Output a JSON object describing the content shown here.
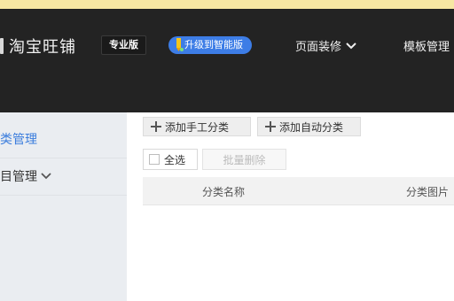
{
  "header": {
    "brand": "淘宝旺铺",
    "edition": "专业版",
    "upgrade_label": "升级到智能版",
    "nav": [
      {
        "label": "页面装修"
      },
      {
        "label": "模板管理"
      }
    ]
  },
  "sidebar": {
    "items": [
      {
        "label": "类管理",
        "active": true
      },
      {
        "label": "目管理"
      }
    ]
  },
  "toolbar": {
    "add_manual": "添加手工分类",
    "add_auto": "添加自动分类",
    "select_all": "全选",
    "batch_delete": "批量删除"
  },
  "table": {
    "columns": [
      "分类名称",
      "分类图片"
    ]
  },
  "colors": {
    "topbar": "#232323",
    "accent": "#3b7ddd",
    "upgrade": "#3d7de6",
    "sidebar": "#eaedf1"
  },
  "icons": {
    "nav_dropdown": "chevron-down-icon",
    "upgrade": "upgrade-pencil-icon",
    "add": "plus-icon"
  }
}
